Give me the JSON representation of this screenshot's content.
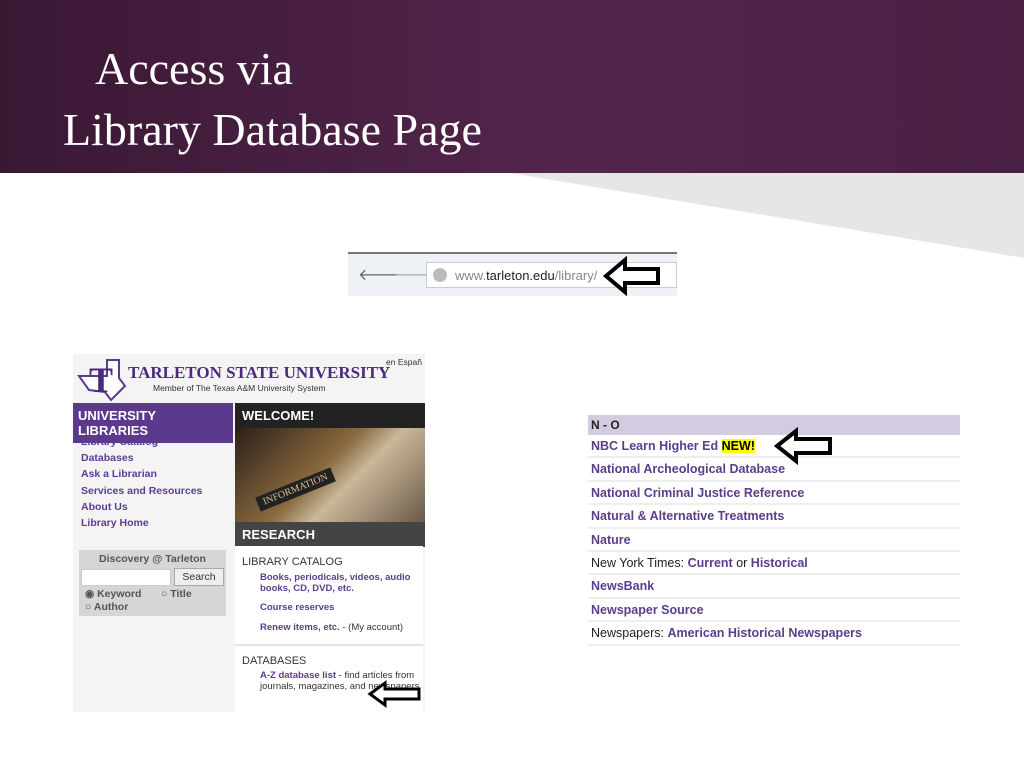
{
  "slide": {
    "title_line1": "Access via",
    "title_line2": "Library Database Page"
  },
  "browser": {
    "url_prefix": "www.",
    "url_domain": "tarleton.edu",
    "url_path": "/library/"
  },
  "tsu": {
    "name": "TARLETON STATE UNIVERSITY",
    "member": "Member of The Texas A&M University System",
    "lang": "en Españ",
    "side_header": "UNIVERSITY LIBRARIES",
    "side_links": [
      "Library Catalog",
      "Databases",
      "Ask a Librarian",
      "Services and Resources",
      "About Us",
      "Library Home"
    ],
    "discovery": {
      "title": "Discovery @ Tarleton",
      "search_value": "",
      "search_button": "Search",
      "opt_keyword": "Keyword",
      "opt_title": "Title",
      "opt_author": "Author"
    },
    "welcome": "WELCOME!",
    "image_sign": "INFORMATION",
    "research": "RESEARCH",
    "catalog": {
      "heading": "LIBRARY CATALOG",
      "link1": "Books, periodicals, videos, audio books, CD, DVD, etc.",
      "link2": "Course reserves",
      "link3": "Renew items, etc.",
      "link3_suffix": " - (My account)"
    },
    "databases": {
      "heading": "DATABASES",
      "link": "A-Z database list",
      "desc": " - find articles from journals, magazines, and newspapers"
    }
  },
  "az": {
    "header": "N - O",
    "new_badge": "NEW!",
    "rows": [
      {
        "link": "NBC Learn Higher Ed"
      },
      {
        "link": "National Archeological Database"
      },
      {
        "link": "National Criminal Justice Reference"
      },
      {
        "link": "Natural & Alternative Treatments"
      },
      {
        "link": "Nature"
      }
    ],
    "nyt": {
      "prefix": "New York Times: ",
      "l1": "Current",
      "mid": " or ",
      "l2": "Historical"
    },
    "newsbank": "NewsBank",
    "newspaper_source": "Newspaper Source",
    "newspapers": {
      "prefix": "Newspapers: ",
      "link": "American Historical Newspapers"
    }
  }
}
